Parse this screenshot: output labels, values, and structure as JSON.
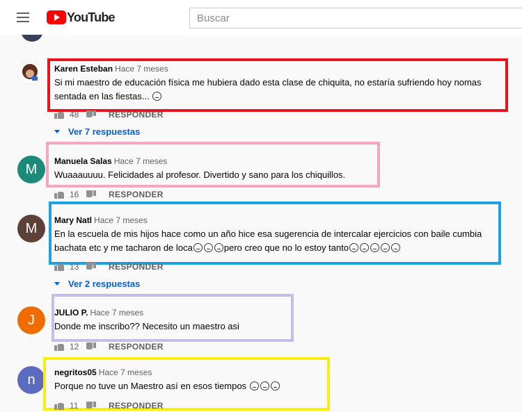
{
  "header": {
    "logo_text": "YouTube",
    "search_placeholder": "Buscar"
  },
  "comments": [
    {
      "author": "Karen Esteban",
      "time": "Hace 7 meses",
      "text": "Si mi maestro de educación física me hubiera dado esta clase de chiquita, no estaría sufriendo hoy nomas sentada en las fiestas...",
      "likes": "48",
      "reply": "RESPONDER",
      "view_replies": "Ver 7 respuestas",
      "highlight_color": "#e8141d"
    },
    {
      "author": "Manuela Salas",
      "time": "Hace 7 meses",
      "text": "Wuaaauuuu. Felicidades al profesor.  Divertido y sano para los chiquillos.",
      "likes": "16",
      "reply": "RESPONDER",
      "avatar_letter": "M",
      "highlight_color": "#f4a6c1"
    },
    {
      "author": "Mary Natl",
      "time": "Hace 7 meses",
      "text_a": "En la escuela de mis hijos hace como un año hice esa sugerencia de intercalar ejercicios con baile cumbia",
      "text_b1": "bachata etc y me tacharon de loca",
      "text_b2": "pero creo que no lo estoy tanto",
      "likes": "13",
      "reply": "RESPONDER",
      "avatar_letter": "M",
      "view_replies": "Ver 2 respuestas",
      "highlight_color": "#1aa3e0"
    },
    {
      "author": "JULIO P.",
      "time": "Hace 7 meses",
      "text": "Donde me inscribo?? Necesito un maestro asi",
      "likes": "12",
      "reply": "RESPONDER",
      "avatar_letter": "J",
      "highlight_color": "#c5bde6"
    },
    {
      "author": "negritos05",
      "time": "Hace 7 meses",
      "text": "Porque no tuve un Maestro así en esos tiempos",
      "likes": "11",
      "reply": "RESPONDER",
      "avatar_letter": "n",
      "highlight_color": "#fbee0e"
    }
  ],
  "avatar_colors": [
    "#1b8a78",
    "#5d4037",
    "#ef6c00",
    "#5c6bc0"
  ]
}
